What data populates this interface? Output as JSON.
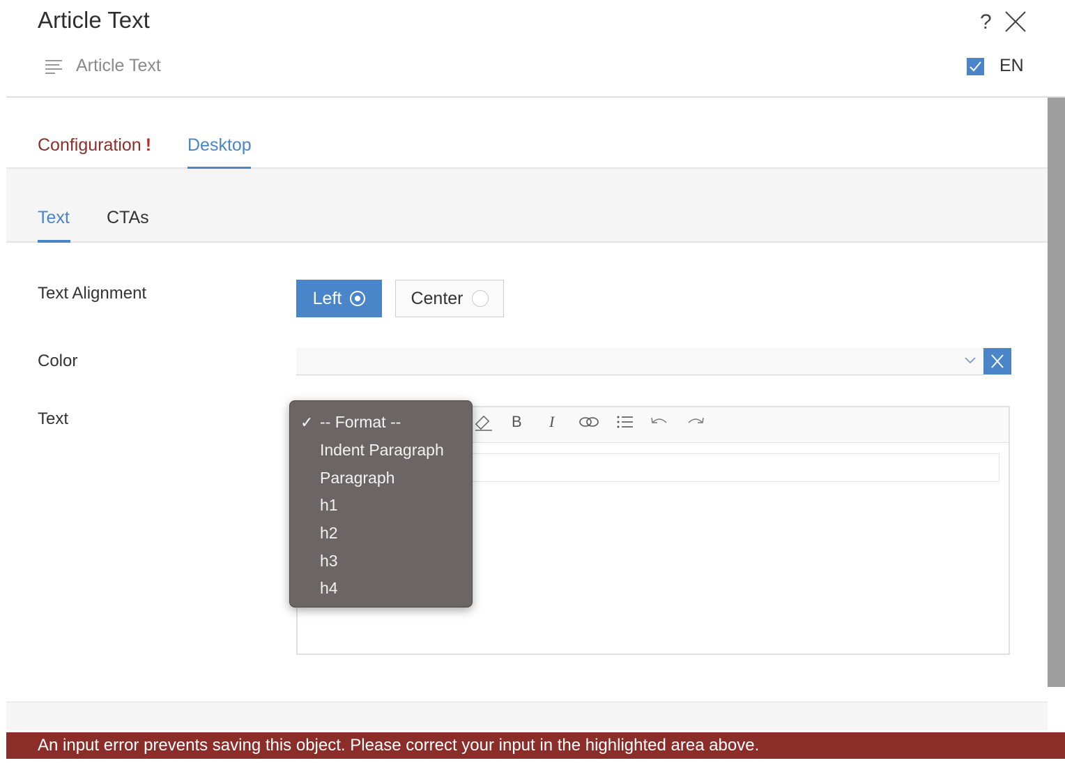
{
  "dialog": {
    "title": "Article Text",
    "help": "?",
    "subtitle": "Article Text",
    "language": "EN",
    "language_checked": true
  },
  "tabs": [
    {
      "label": "Configuration",
      "error_mark": "!"
    },
    {
      "label": "Desktop",
      "active": true
    }
  ],
  "subtabs": [
    {
      "label": "Text",
      "active": true
    },
    {
      "label": "CTAs"
    }
  ],
  "form": {
    "alignment_label": "Text Alignment",
    "alignment_options": [
      {
        "label": "Left",
        "selected": true
      },
      {
        "label": "Center",
        "selected": false
      }
    ],
    "color_label": "Color",
    "color_value": "",
    "text_label": "Text"
  },
  "toolbar": {
    "icons": [
      "eraser-icon",
      "bold-icon",
      "italic-icon",
      "link-icon",
      "list-icon",
      "undo-icon",
      "redo-icon"
    ],
    "bold": "B",
    "italic": "I"
  },
  "format_menu": {
    "check": "✓",
    "items": [
      "-- Format --",
      "Indent Paragraph",
      "Paragraph",
      "h1",
      "h2",
      "h3",
      "h4"
    ],
    "selected_index": 0
  },
  "error": {
    "message": "An input error prevents saving this object. Please correct your input in the highlighted area above."
  },
  "colors": {
    "accent": "#4a84c9",
    "error": "#8b2e2a",
    "menu_bg": "#6b6664"
  }
}
